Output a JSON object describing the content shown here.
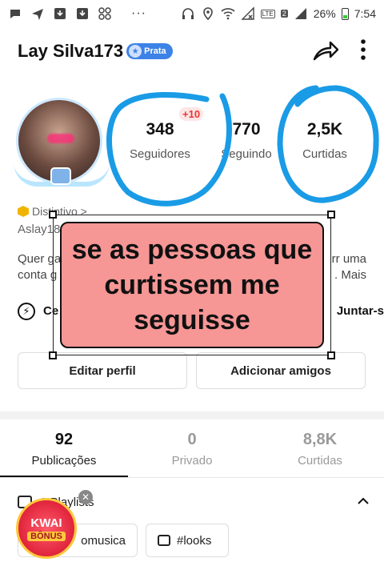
{
  "status_bar": {
    "icons_left": [
      "chat-icon",
      "send-icon",
      "download-icon",
      "download-icon",
      "apps-icon"
    ],
    "more_dots": "···",
    "icons_right": [
      "headset-icon",
      "location-icon",
      "wifi-icon",
      "no-signal-icon",
      "lte-icon",
      "signal-icon"
    ],
    "lte_label": "LTE",
    "sim_number": "2",
    "battery": "26%",
    "time": "7:54"
  },
  "header": {
    "username": "Lay Silva173",
    "badge_label": "Prata"
  },
  "stats": {
    "followers": {
      "value": "348",
      "label": "Seguidores",
      "badge": "+10"
    },
    "following": {
      "value": "770",
      "label": "Seguindo"
    },
    "likes": {
      "value": "2,5K",
      "label": "Curtidas"
    }
  },
  "profile": {
    "distintivo": "Distintivo >",
    "handle": "Aslay18",
    "bio_left_1": "Quer ga",
    "bio_left_2": "conta g",
    "bio_right_1": "rr uma",
    "bio_right_2": ". Mais",
    "link_left": "Ce",
    "link_right": "Juntar-s"
  },
  "overlay": {
    "line1": "se as pessoas que",
    "line2": "curtissem me",
    "line3": "seguisse"
  },
  "buttons": {
    "edit_profile": "Editar perfil",
    "add_friends": "Adicionar amigos"
  },
  "tabs": [
    {
      "count": "92",
      "label": "Publicações",
      "active": true
    },
    {
      "count": "0",
      "label": "Privado",
      "active": false
    },
    {
      "count": "8,8K",
      "label": "Curtidas",
      "active": false
    }
  ],
  "playlists": {
    "label": "2 Playlists",
    "chips": [
      "omusica",
      "#looks"
    ]
  },
  "kwai_bonus": {
    "line1": "KWAI",
    "line2": "BÔNUS"
  },
  "colors": {
    "scribble": "#1a9be6",
    "overlay_fill": "#f69695",
    "rank_badge": "#3d82e6",
    "plus_badge": "#ee3333"
  }
}
